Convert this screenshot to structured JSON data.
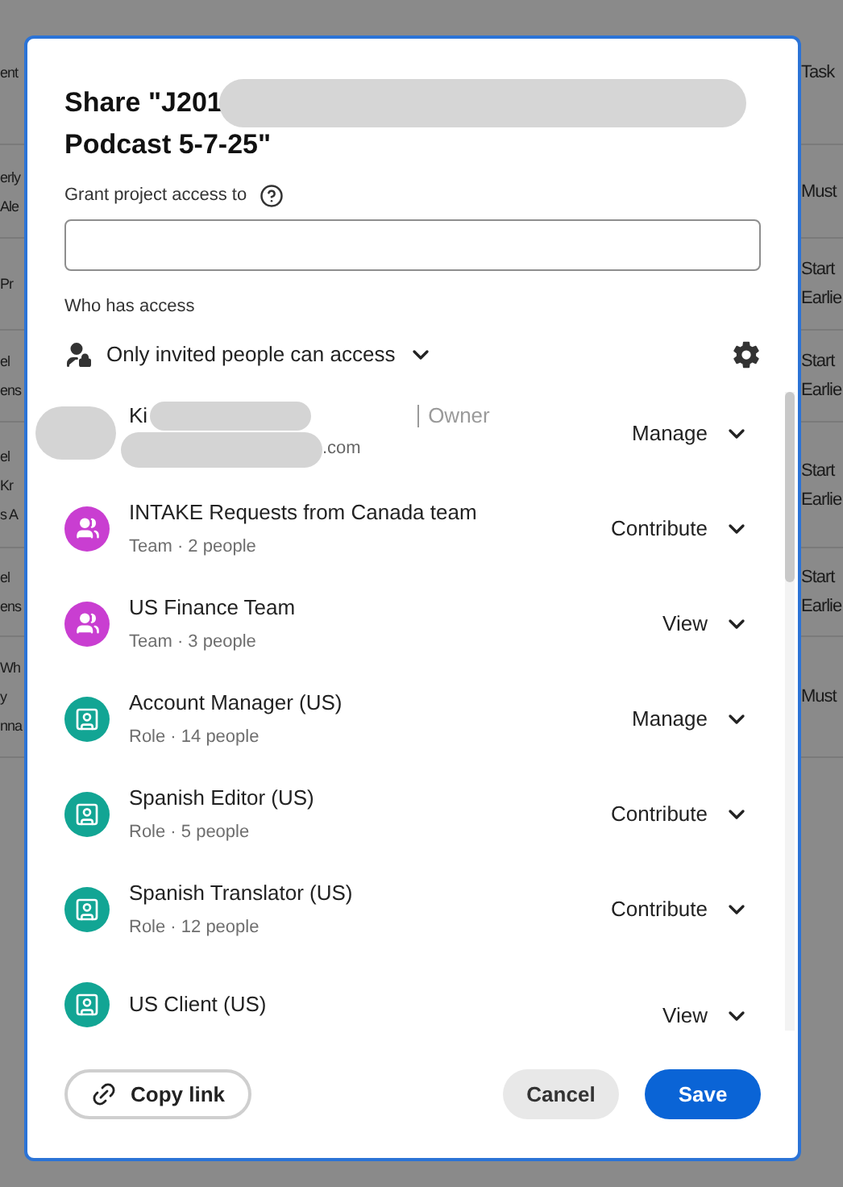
{
  "background_table": {
    "header": {
      "left": [
        "ent"
      ],
      "right": [
        "Task"
      ]
    },
    "rows": [
      {
        "left": [
          "erly",
          "Ale"
        ],
        "right": [
          "Must"
        ]
      },
      {
        "left": [
          "Pr"
        ],
        "right": [
          "Start",
          "Earlie"
        ]
      },
      {
        "left": [
          "el",
          "ens"
        ],
        "right": [
          "Start",
          "Earlie"
        ]
      },
      {
        "left": [
          "el",
          "Kr",
          "s A"
        ],
        "right": [
          "Start",
          "Earlie"
        ]
      },
      {
        "left": [
          "el",
          "ens"
        ],
        "right": [
          "Start",
          "Earlie"
        ]
      },
      {
        "left": [
          "Wh",
          "y",
          "nna"
        ],
        "right": [
          "Must"
        ]
      }
    ]
  },
  "dialog": {
    "title_start": "Share \"J201",
    "title_end": "Podcast 5-7-25\"",
    "grant_label": "Grant project access to",
    "who_has_access_label": "Who has access",
    "access_setting": "Only invited people can access",
    "members": [
      {
        "kind": "owner",
        "name": "Ki",
        "email": ".com",
        "tag": "Owner",
        "permission": "Manage"
      },
      {
        "kind": "team",
        "name": "INTAKE Requests from Canada team",
        "detail": "Team · 2 people",
        "permission": "Contribute"
      },
      {
        "kind": "team",
        "name": "US Finance Team",
        "detail": "Team · 3 people",
        "permission": "View"
      },
      {
        "kind": "role",
        "name": "Account Manager (US)",
        "detail": "Role · 14 people",
        "permission": "Manage"
      },
      {
        "kind": "role",
        "name": "Spanish Editor (US)",
        "detail": "Role · 5 people",
        "permission": "Contribute"
      },
      {
        "kind": "role",
        "name": "Spanish Translator (US)",
        "detail": "Role · 12 people",
        "permission": "Contribute"
      },
      {
        "kind": "role",
        "name": "US Client (US)",
        "permission": "View"
      }
    ],
    "copy_link": "Copy link",
    "cancel": "Cancel",
    "save": "Save"
  }
}
